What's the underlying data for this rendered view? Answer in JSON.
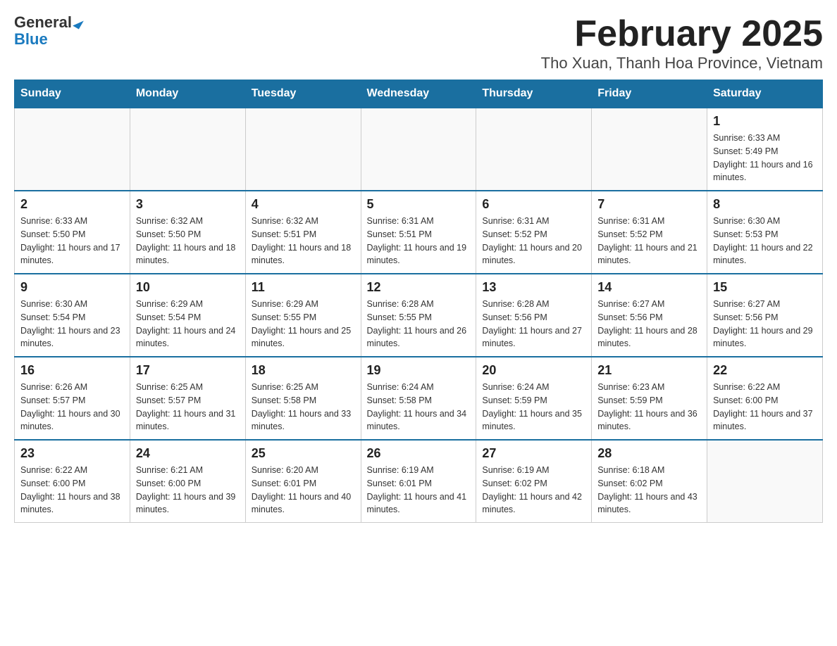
{
  "header": {
    "logo": {
      "general": "General",
      "blue": "Blue"
    },
    "title": "February 2025",
    "subtitle": "Tho Xuan, Thanh Hoa Province, Vietnam"
  },
  "calendar": {
    "days_of_week": [
      "Sunday",
      "Monday",
      "Tuesday",
      "Wednesday",
      "Thursday",
      "Friday",
      "Saturday"
    ],
    "weeks": [
      [
        {
          "day": "",
          "info": ""
        },
        {
          "day": "",
          "info": ""
        },
        {
          "day": "",
          "info": ""
        },
        {
          "day": "",
          "info": ""
        },
        {
          "day": "",
          "info": ""
        },
        {
          "day": "",
          "info": ""
        },
        {
          "day": "1",
          "info": "Sunrise: 6:33 AM\nSunset: 5:49 PM\nDaylight: 11 hours and 16 minutes."
        }
      ],
      [
        {
          "day": "2",
          "info": "Sunrise: 6:33 AM\nSunset: 5:50 PM\nDaylight: 11 hours and 17 minutes."
        },
        {
          "day": "3",
          "info": "Sunrise: 6:32 AM\nSunset: 5:50 PM\nDaylight: 11 hours and 18 minutes."
        },
        {
          "day": "4",
          "info": "Sunrise: 6:32 AM\nSunset: 5:51 PM\nDaylight: 11 hours and 18 minutes."
        },
        {
          "day": "5",
          "info": "Sunrise: 6:31 AM\nSunset: 5:51 PM\nDaylight: 11 hours and 19 minutes."
        },
        {
          "day": "6",
          "info": "Sunrise: 6:31 AM\nSunset: 5:52 PM\nDaylight: 11 hours and 20 minutes."
        },
        {
          "day": "7",
          "info": "Sunrise: 6:31 AM\nSunset: 5:52 PM\nDaylight: 11 hours and 21 minutes."
        },
        {
          "day": "8",
          "info": "Sunrise: 6:30 AM\nSunset: 5:53 PM\nDaylight: 11 hours and 22 minutes."
        }
      ],
      [
        {
          "day": "9",
          "info": "Sunrise: 6:30 AM\nSunset: 5:54 PM\nDaylight: 11 hours and 23 minutes."
        },
        {
          "day": "10",
          "info": "Sunrise: 6:29 AM\nSunset: 5:54 PM\nDaylight: 11 hours and 24 minutes."
        },
        {
          "day": "11",
          "info": "Sunrise: 6:29 AM\nSunset: 5:55 PM\nDaylight: 11 hours and 25 minutes."
        },
        {
          "day": "12",
          "info": "Sunrise: 6:28 AM\nSunset: 5:55 PM\nDaylight: 11 hours and 26 minutes."
        },
        {
          "day": "13",
          "info": "Sunrise: 6:28 AM\nSunset: 5:56 PM\nDaylight: 11 hours and 27 minutes."
        },
        {
          "day": "14",
          "info": "Sunrise: 6:27 AM\nSunset: 5:56 PM\nDaylight: 11 hours and 28 minutes."
        },
        {
          "day": "15",
          "info": "Sunrise: 6:27 AM\nSunset: 5:56 PM\nDaylight: 11 hours and 29 minutes."
        }
      ],
      [
        {
          "day": "16",
          "info": "Sunrise: 6:26 AM\nSunset: 5:57 PM\nDaylight: 11 hours and 30 minutes."
        },
        {
          "day": "17",
          "info": "Sunrise: 6:25 AM\nSunset: 5:57 PM\nDaylight: 11 hours and 31 minutes."
        },
        {
          "day": "18",
          "info": "Sunrise: 6:25 AM\nSunset: 5:58 PM\nDaylight: 11 hours and 33 minutes."
        },
        {
          "day": "19",
          "info": "Sunrise: 6:24 AM\nSunset: 5:58 PM\nDaylight: 11 hours and 34 minutes."
        },
        {
          "day": "20",
          "info": "Sunrise: 6:24 AM\nSunset: 5:59 PM\nDaylight: 11 hours and 35 minutes."
        },
        {
          "day": "21",
          "info": "Sunrise: 6:23 AM\nSunset: 5:59 PM\nDaylight: 11 hours and 36 minutes."
        },
        {
          "day": "22",
          "info": "Sunrise: 6:22 AM\nSunset: 6:00 PM\nDaylight: 11 hours and 37 minutes."
        }
      ],
      [
        {
          "day": "23",
          "info": "Sunrise: 6:22 AM\nSunset: 6:00 PM\nDaylight: 11 hours and 38 minutes."
        },
        {
          "day": "24",
          "info": "Sunrise: 6:21 AM\nSunset: 6:00 PM\nDaylight: 11 hours and 39 minutes."
        },
        {
          "day": "25",
          "info": "Sunrise: 6:20 AM\nSunset: 6:01 PM\nDaylight: 11 hours and 40 minutes."
        },
        {
          "day": "26",
          "info": "Sunrise: 6:19 AM\nSunset: 6:01 PM\nDaylight: 11 hours and 41 minutes."
        },
        {
          "day": "27",
          "info": "Sunrise: 6:19 AM\nSunset: 6:02 PM\nDaylight: 11 hours and 42 minutes."
        },
        {
          "day": "28",
          "info": "Sunrise: 6:18 AM\nSunset: 6:02 PM\nDaylight: 11 hours and 43 minutes."
        },
        {
          "day": "",
          "info": ""
        }
      ]
    ]
  }
}
